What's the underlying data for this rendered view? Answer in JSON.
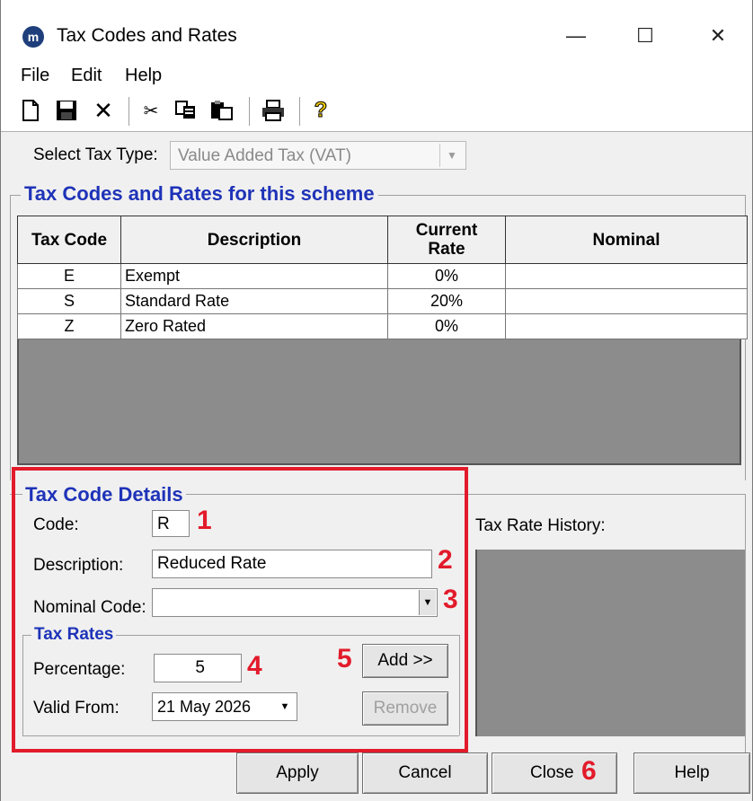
{
  "window": {
    "title": "Tax Codes and Rates",
    "app_icon_letter": "m",
    "controls": {
      "minimize": "—",
      "maximize": "☐",
      "close": "✕"
    }
  },
  "menu": [
    "File",
    "Edit",
    "Help"
  ],
  "toolbar": [
    "new-file-icon",
    "save-icon",
    "delete-icon",
    "cut-icon",
    "copy-icon",
    "paste-icon",
    "print-icon",
    "help-icon"
  ],
  "tax_type": {
    "label": "Select Tax Type:",
    "value": "Value Added Tax (VAT)"
  },
  "scheme_group": {
    "title": "Tax Codes and Rates for this scheme",
    "columns": [
      "Tax Code",
      "Description",
      "Current Rate",
      "Nominal"
    ],
    "rows": [
      {
        "code": "E",
        "description": "Exempt",
        "rate": "0%",
        "nominal": ""
      },
      {
        "code": "S",
        "description": "Standard Rate",
        "rate": "20%",
        "nominal": ""
      },
      {
        "code": "Z",
        "description": "Zero Rated",
        "rate": "0%",
        "nominal": ""
      }
    ]
  },
  "details": {
    "title": "Tax Code Details",
    "code_label": "Code:",
    "code_value": "R",
    "description_label": "Description:",
    "description_value": "Reduced Rate",
    "nominal_label": "Nominal Code:",
    "nominal_value": "",
    "history_label": "Tax Rate History:"
  },
  "tax_rates": {
    "title": "Tax Rates",
    "percentage_label": "Percentage:",
    "percentage_value": "5",
    "valid_from_label": "Valid From:",
    "valid_from_value": "21 May 2026",
    "add_button": "Add >>",
    "remove_button": "Remove"
  },
  "buttons": {
    "apply": "Apply",
    "cancel": "Cancel",
    "close": "Close",
    "help": "Help"
  },
  "annotations": {
    "step1": "1",
    "step2": "2",
    "step3": "3",
    "step4": "4",
    "step5": "5",
    "step6": "6"
  },
  "colors": {
    "group_title": "#1e33b8",
    "annotation_red": "#e21b2b",
    "grid_empty": "#8c8c8c",
    "window_bg": "#f0f0f0"
  }
}
